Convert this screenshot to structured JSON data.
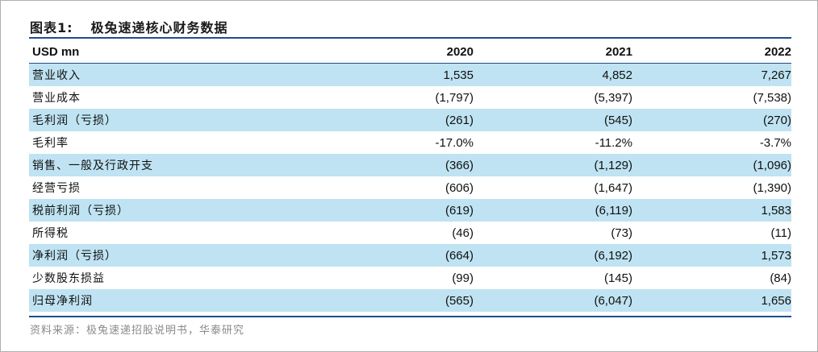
{
  "title": {
    "figure": "图表1:",
    "text": "极兔速递核心财务数据"
  },
  "table": {
    "header": [
      "USD mn",
      "2020",
      "2021",
      "2022"
    ],
    "rows": [
      {
        "label": "营业收入",
        "values": [
          "1,535",
          "4,852",
          "7,267"
        ]
      },
      {
        "label": "营业成本",
        "values": [
          "(1,797)",
          "(5,397)",
          "(7,538)"
        ]
      },
      {
        "label": "毛利润（亏损）",
        "values": [
          "(261)",
          "(545)",
          "(270)"
        ]
      },
      {
        "label": "毛利率",
        "values": [
          "-17.0%",
          "-11.2%",
          "-3.7%"
        ]
      },
      {
        "label": "销售、一般及行政开支",
        "values": [
          "(366)",
          "(1,129)",
          "(1,096)"
        ]
      },
      {
        "label": "经营亏损",
        "values": [
          "(606)",
          "(1,647)",
          "(1,390)"
        ]
      },
      {
        "label": "税前利润（亏损）",
        "values": [
          "(619)",
          "(6,119)",
          "1,583"
        ]
      },
      {
        "label": "所得税",
        "values": [
          "(46)",
          "(73)",
          "(11)"
        ]
      },
      {
        "label": "净利润（亏损）",
        "values": [
          "(664)",
          "(6,192)",
          "1,573"
        ]
      },
      {
        "label": "少数股东损益",
        "values": [
          "(99)",
          "(145)",
          "(84)"
        ]
      },
      {
        "label": "归母净利润",
        "values": [
          "(565)",
          "(6,047)",
          "1,656"
        ]
      }
    ]
  },
  "source": "资料来源：极兔速递招股说明书，华泰研究",
  "colors": {
    "shade": "#bfe3f2",
    "rule": "#1f4e8c",
    "source_text": "#8a8a8a"
  }
}
